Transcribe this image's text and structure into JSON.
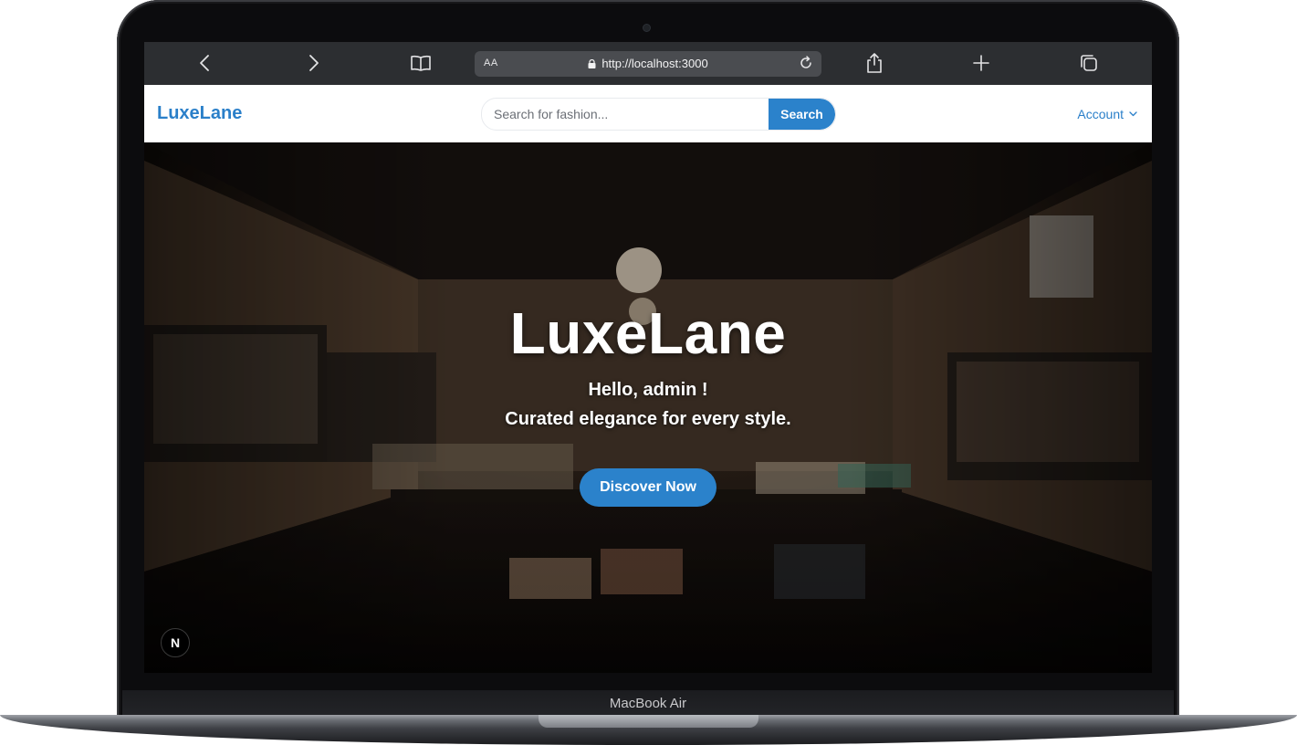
{
  "device": {
    "label": "MacBook Air"
  },
  "browser": {
    "address": {
      "text_size_label": "AA",
      "url": "http://localhost:3000"
    },
    "icons": {
      "back": "chevron-left-icon",
      "forward": "chevron-right-icon",
      "bookmarks": "book-icon",
      "reload": "reload-icon",
      "share": "share-icon",
      "new_tab": "plus-icon",
      "tabs": "tabs-icon"
    }
  },
  "site": {
    "brand": "LuxeLane",
    "search": {
      "placeholder": "Search for fashion...",
      "button_label": "Search"
    },
    "account_label": "Account",
    "colors": {
      "accent": "#2b82cb"
    }
  },
  "hero": {
    "title": "LuxeLane",
    "greeting": "Hello, admin !",
    "tagline": "Curated elegance for every style.",
    "cta_label": "Discover Now"
  },
  "dev_badge": {
    "label": "N"
  }
}
